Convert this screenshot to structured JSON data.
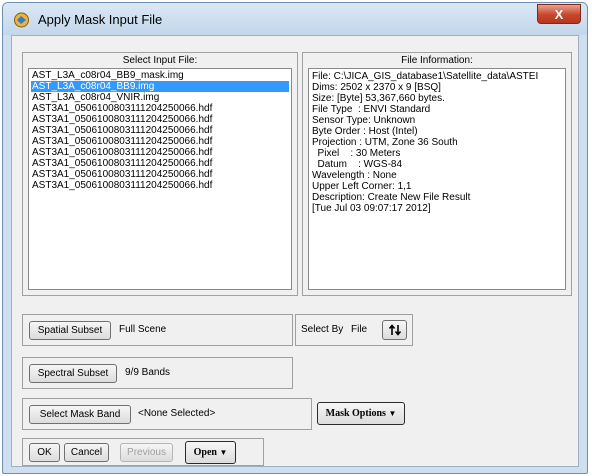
{
  "window": {
    "title": "Apply Mask Input File",
    "close_label": "X"
  },
  "input_panel": {
    "title": "Select Input File:",
    "files": [
      "AST_L3A_c08r04_BB9_mask.img",
      "AST_L3A_c08r04_BB9.img",
      "AST_L3A_c08r04_VNIR.img",
      "AST3A1_0506100803111204250066.hdf",
      "AST3A1_0506100803111204250066.hdf",
      "AST3A1_0506100803111204250066.hdf",
      "AST3A1_0506100803111204250066.hdf",
      "AST3A1_0506100803111204250066.hdf",
      "AST3A1_0506100803111204250066.hdf",
      "AST3A1_0506100803111204250066.hdf",
      "AST3A1_0506100803111204250066.hdf"
    ],
    "selected_index": 1
  },
  "info_panel": {
    "title": "File Information:",
    "lines": [
      "File: C:\\JICA_GIS_database1\\Satellite_data\\ASTEI",
      "Dims: 2502 x 2370 x 9 [BSQ]",
      "Size: [Byte] 53,367,660 bytes.",
      "File Type  : ENVI Standard",
      "Sensor Type: Unknown",
      "Byte Order : Host (Intel)",
      "Projection : UTM, Zone 36 South",
      "  Pixel    : 30 Meters",
      "  Datum    : WGS-84",
      "Wavelength : None",
      "Upper Left Corner: 1,1",
      "Description: Create New File Result",
      "[Tue Jul 03 09:07:17 2012]"
    ]
  },
  "spatial_subset": {
    "button": "Spatial Subset",
    "value": "Full Scene"
  },
  "select_by": {
    "label": "Select By",
    "value": "File",
    "sort_icon": "sort-arrows"
  },
  "spectral_subset": {
    "button": "Spectral Subset",
    "value": "9/9 Bands"
  },
  "mask_band": {
    "button": "Select Mask Band",
    "value": "<None Selected>",
    "options_button": "Mask Options"
  },
  "bottom_buttons": {
    "ok": "OK",
    "cancel": "Cancel",
    "previous": "Previous",
    "open": "Open"
  },
  "colors": {
    "selection": "#3399ff",
    "close": "#c8462c"
  }
}
